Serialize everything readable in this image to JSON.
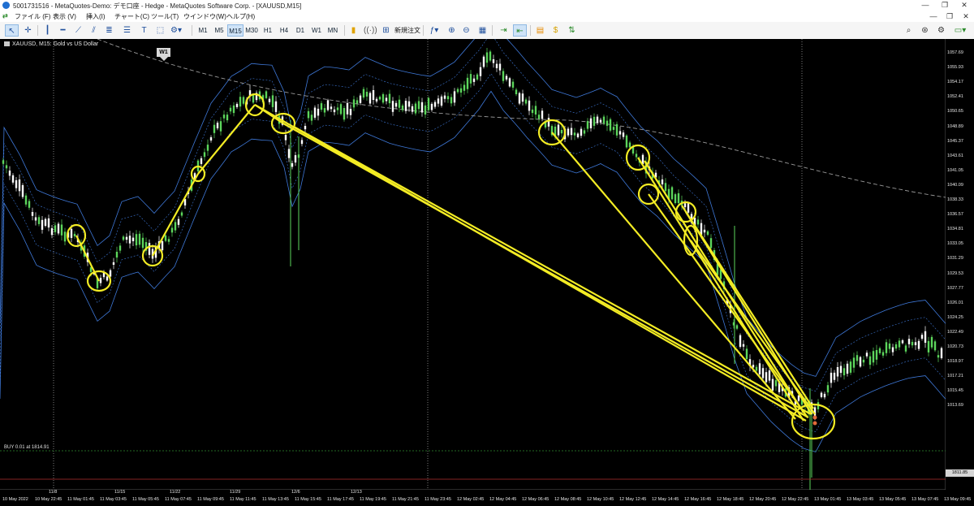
{
  "window": {
    "title": "5001731516 - MetaQuotes-Demo: デモ口座 - Hedge - MetaQuotes Software Corp. - [XAUUSD,M15]",
    "controls": [
      "—",
      "❐",
      "✕"
    ]
  },
  "menu": {
    "items": [
      "ファイル (F)",
      "表示 (V)",
      "挿入(I)",
      "チャート(C)",
      "ツール(T)",
      "ウインドウ(W)",
      "ヘルプ(H)"
    ],
    "mdi_controls": [
      "—",
      "❐",
      "✕"
    ]
  },
  "toolbar": {
    "timeframes": [
      "M1",
      "M5",
      "M15",
      "M30",
      "H1",
      "H4",
      "D1",
      "W1",
      "MN"
    ],
    "selected_timeframe": "M15",
    "new_order_label": "新規注文",
    "tools": [
      "cursor-icon",
      "crosshair-icon",
      "vertical-line-icon",
      "horizontal-line-icon",
      "trend-line-icon",
      "channel-icon",
      "fibonacci-icon",
      "text-icon",
      "shapes-icon"
    ]
  },
  "chart": {
    "symbol_label": "XAUUSD, M15:  Gold vs US Dollar",
    "week_badge": "W1",
    "buy_label": "BUY 0.01 at 1814.91",
    "current_price": "1811.85",
    "colors": {
      "background": "#000000",
      "bull": "#5cd65c",
      "bear": "#ffffff",
      "band": "#3e78d8",
      "annotation": "#f3ec24",
      "buy_line": "#2e8b2e",
      "ma": "#9a9a9a"
    },
    "price_scale": [
      "1057.69",
      "1055.93",
      "1054.17",
      "1052.41",
      "1050.65",
      "1048.89",
      "1045.37",
      "1043.61",
      "1041.05",
      "1040.09",
      "1038.33",
      "1036.57",
      "1034.81",
      "1033.05",
      "1031.29",
      "1029.53",
      "1027.77",
      "1026.01",
      "1024.25",
      "1022.49",
      "1020.73",
      "1018.97",
      "1017.21",
      "1015.45",
      "1013.69"
    ],
    "time_labels": [
      "10 May 2022",
      "10 May 22:45",
      "11 May 01:45",
      "11 May 03:45",
      "11 May 05:45",
      "11 May 07:45",
      "11 May 09:45",
      "11 May 11:45",
      "11 May 13:45",
      "11 May 15:45",
      "11 May 17:45",
      "11 May 19:45",
      "11 May 21:45",
      "11 May 23:45",
      "12 May 02:45",
      "12 May 04:45",
      "12 May 06:45",
      "12 May 08:45",
      "12 May 10:45",
      "12 May 12:45",
      "12 May 14:45",
      "12 May 16:45",
      "12 May 18:45",
      "12 May 20:45",
      "12 May 22:45",
      "13 May 01:45",
      "13 May 03:45",
      "13 May 05:45",
      "13 May 07:45",
      "13 May 09:45"
    ],
    "week_labels": [
      "11/8",
      "11/15",
      "11/22",
      "11/29",
      "12/6",
      "12/13"
    ]
  }
}
